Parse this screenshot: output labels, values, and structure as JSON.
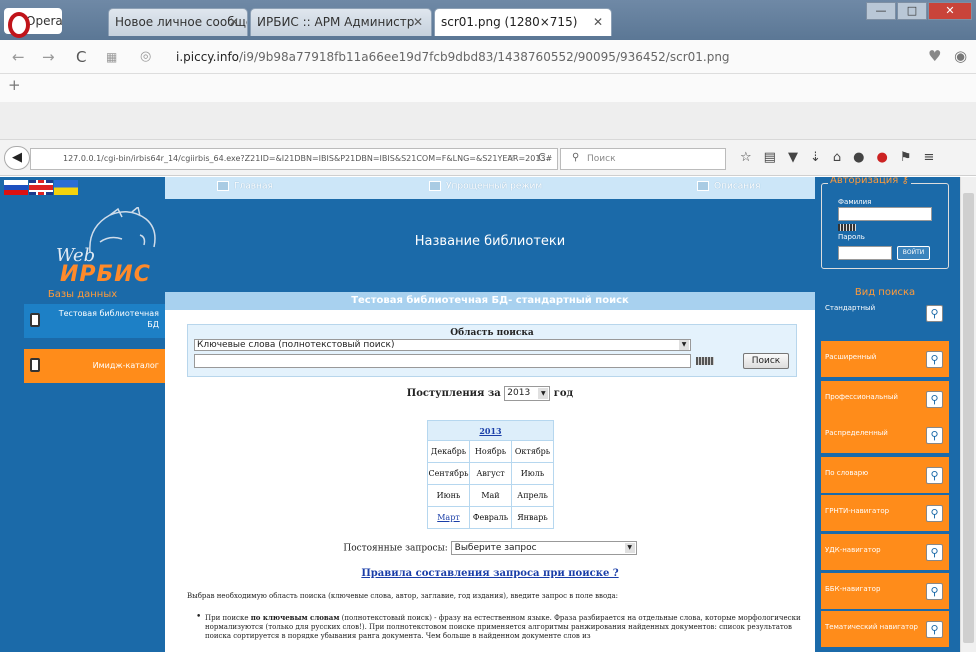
{
  "opera": {
    "menu_label": "Opera",
    "tabs": [
      {
        "label": "Новое личное сообщение",
        "close": "✕"
      },
      {
        "label": "ИРБИС :: АРМ Администр",
        "close": "✕"
      },
      {
        "label": "scr01.png (1280×715)",
        "close": "✕"
      }
    ],
    "url_domain": "i.piccy.info",
    "url_path": "/i9/9b98a77918fb11a66ee19d7fcb9dbd83/1438760552/90095/936452/scr01.png",
    "add_tab": "+",
    "win_minimize": "—",
    "win_maximize": "□",
    "win_close": "✕"
  },
  "firefox": {
    "url": "127.0.0.1/cgi-bin/irbis64r_14/cgiirbis_64.exe?Z21ID=&I21DBN=IBIS&P21DBN=IBIS&S21COM=F&LNG=&S21YEAR=2013#",
    "search_placeholder": "Поиск"
  },
  "site": {
    "logo_web": "Web",
    "logo_irbis": "ИРБИС",
    "nav": {
      "home": "Главная",
      "simple": "Упрощенный режим",
      "descriptions": "Описания"
    },
    "library_name": "Название библиотеки",
    "databases": {
      "title": "Базы данных",
      "items": [
        {
          "label": "Тестовая библиотечная БД"
        },
        {
          "label": "Имидж-каталог"
        }
      ]
    },
    "auth": {
      "title": "Авторизация",
      "surname_label": "Фамилия",
      "password_label": "Пароль",
      "login_button": "ВОЙТИ"
    },
    "search_types": {
      "title": "Вид поиска",
      "items": [
        {
          "label": "Стандартный"
        },
        {
          "label": "Расширенный"
        },
        {
          "label": "Профессиональный"
        },
        {
          "label": "Распределенный"
        },
        {
          "label": "По словарю"
        },
        {
          "label": "ГРНТИ-навигатор"
        },
        {
          "label": "УДК-навигатор"
        },
        {
          "label": "ББК-навигатор"
        },
        {
          "label": "Тематический навигатор"
        }
      ]
    },
    "main": {
      "title": "Тестовая библиотечная БД- стандартный поиск",
      "search_area_label": "Область поиска",
      "search_area_value": "Ключевые слова (полнотекстовый поиск)",
      "query_value": "",
      "search_button": "Поиск",
      "arrivals_prefix": "Поступления за",
      "arrivals_year": "2013",
      "arrivals_suffix": "год",
      "calendar": {
        "year": "2013",
        "rows": [
          [
            "Декабрь",
            "Ноябрь",
            "Октябрь"
          ],
          [
            "Сентябрь",
            "Август",
            "Июль"
          ],
          [
            "Июнь",
            "Май",
            "Апрель"
          ],
          [
            "Март",
            "Февраль",
            "Январь"
          ]
        ]
      },
      "permanent_label": "Постоянные запросы:",
      "permanent_value": "Выберите запрос",
      "rules_link": "Правила составления запроса при поиске ?",
      "intro": "Выбрав необходимую область поиска (ключевые слова, автор, заглавие, год издания), введите запрос в поле ввода:",
      "bullet_prefix": "При поиске ",
      "bullet_bold": "по ключевым словам",
      "bullet_text": " (полнотекстовый поиск) - фразу на естественном языке. Фраза разбирается на отдельные слова, которые морфологически нормализуются (только для русских слов!). При полнотекстовом поиске применяется алгоритмы ранжирования найденных документов: список результатов поиска сортируется в порядке убывания ранга документа. Чем больше в найденном документе слов из"
    }
  }
}
